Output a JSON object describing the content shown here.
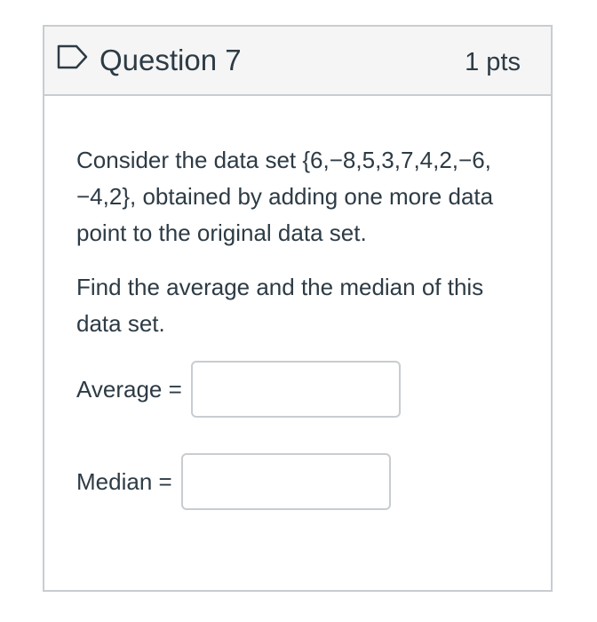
{
  "question": {
    "title": "Question 7",
    "points": "1 pts",
    "flag_icon": "flag-outline-icon",
    "paragraphs": [
      "Consider the data set {6,−8,5,3,7,4,2,−6, −4,2}, obtained by adding one more data point to the original data set.",
      "Find the average and the median of this data set."
    ],
    "answers": [
      {
        "label": "Average =",
        "value": ""
      },
      {
        "label": "Median =",
        "value": ""
      }
    ]
  },
  "colors": {
    "header_bg": "#f5f5f5",
    "border": "#c7cdd1",
    "text": "#2d3b45"
  }
}
